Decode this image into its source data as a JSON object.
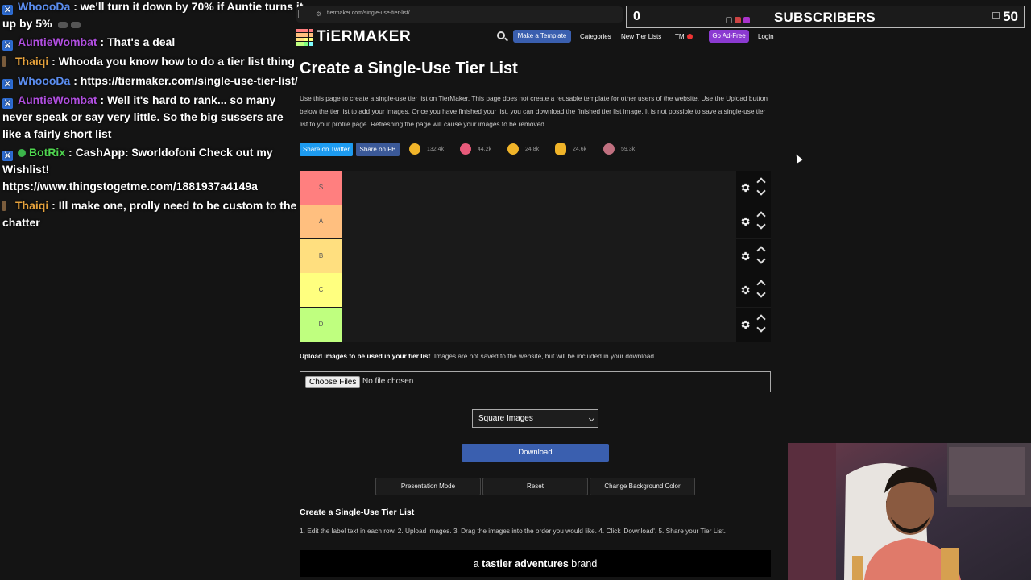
{
  "chat": [
    {
      "badge": "mod",
      "user": "WhoooDa",
      "color": "#5b8def",
      "text": "we'll turn it down by 70% if Auntie turns it up by 5%",
      "emotes": true
    },
    {
      "badge": "mod",
      "user": "AuntieWombat",
      "color": "#b14fe0",
      "text": "That's a deal"
    },
    {
      "badge": "thin",
      "user": "Thaiqi",
      "color": "#e6a23c",
      "text": "Whooda you know how to do a tier list thing"
    },
    {
      "badge": "mod",
      "user": "WhoooDa",
      "color": "#5b8def",
      "text": "https://tiermaker.com/single-use-tier-list/"
    },
    {
      "badge": "mod",
      "user": "AuntieWombat",
      "color": "#b14fe0",
      "text": "Well it's hard to rank... so many never speak or say very little. So the big sussers are like a fairly short list"
    },
    {
      "badge": "mod",
      "verified": true,
      "user": "BotRix",
      "color": "#4fd64f",
      "text": "CashApp: $worldofoni Check out my Wishlist! https://www.thingstogetme.com/1881937a4149a"
    },
    {
      "badge": "thin",
      "user": "Thaiqi",
      "color": "#e6a23c",
      "text": "Ill make one, prolly need to be custom to the chatter"
    }
  ],
  "browser": {
    "url": "tiermaker.com/single-use-tier-list/"
  },
  "subscribers": {
    "current": "0",
    "label": "SUBSCRIBERS",
    "goal": "50"
  },
  "nav": {
    "logo": "TiERMAKER",
    "make_template": "Make a Template",
    "categories": "Categories",
    "new_tier_lists": "New Tier Lists",
    "tm": "TM",
    "go_ad_free": "Go Ad-Free",
    "login": "Login"
  },
  "page": {
    "title": "Create a Single-Use Tier List",
    "intro": "Use this page to create a single-use tier list on TierMaker. This page does not create a reusable template for other users of the website. Use the Upload button below the tier list to add your images. Once you have finished your list, you can download the finished tier list image. It is not possible to save a single-use tier list to your profile page. Refreshing the page will cause your images to be removed."
  },
  "share": {
    "twitter": "Share on Twitter",
    "fb": "Share on FB",
    "reactions": [
      {
        "icon": "grin-face-icon",
        "count": "132.4k",
        "color": "#f0b429"
      },
      {
        "icon": "heart-eyes-face-icon",
        "count": "44.2k",
        "color": "#e85a7a"
      },
      {
        "icon": "laughing-face-icon",
        "count": "24.8k",
        "color": "#f0b429"
      },
      {
        "icon": "raised-hands-icon",
        "count": "24.6k",
        "color": "#f0b429"
      },
      {
        "icon": "poop-icon",
        "count": "59.3k",
        "color": "#c07080"
      }
    ]
  },
  "tiers": [
    {
      "label": "S",
      "color": "#ff7f7f"
    },
    {
      "label": "A",
      "color": "#ffbf7f"
    },
    {
      "label": "B",
      "color": "#ffdf7f"
    },
    {
      "label": "C",
      "color": "#ffff7f"
    },
    {
      "label": "D",
      "color": "#bfff7f"
    }
  ],
  "upload": {
    "bold": "Upload images to be used in your tier list",
    "rest": ". Images are not saved to the website, but will be included in your download.",
    "button": "Choose Files",
    "status": "No file chosen"
  },
  "image_mode": {
    "selected": "Square Images"
  },
  "download": "Download",
  "options": {
    "presentation": "Presentation Mode",
    "reset": "Reset",
    "background": "Change Background Color"
  },
  "how": {
    "title": "Create a Single-Use Tier List",
    "steps": "1. Edit the label text in each row. 2. Upload images. 3. Drag the images into the order you would like. 4. Click 'Download'. 5. Share your Tier List."
  },
  "ad": {
    "pre": "a ",
    "bold": "tastier adventures",
    "post": " brand"
  }
}
